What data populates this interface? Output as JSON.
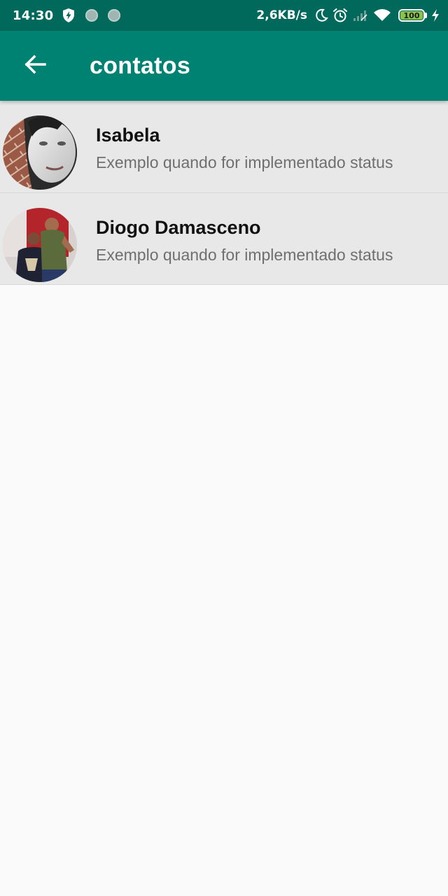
{
  "status_bar": {
    "time": "14:30",
    "net_speed": "2,6KB/s",
    "battery_level": "100",
    "icons": [
      "shield-bolt-icon",
      "notification-dot-icon",
      "notification-dot-icon",
      "moon-icon",
      "alarm-icon",
      "cellular-signal-icon",
      "wifi-icon",
      "battery-icon",
      "charging-bolt-icon"
    ]
  },
  "app_bar": {
    "title": "contatos",
    "back_icon": "arrow-left-icon",
    "background_color": "#008272"
  },
  "contacts": [
    {
      "name": "Isabela",
      "status": "Exemplo quando for implementado status",
      "avatar": "contact-photo"
    },
    {
      "name": "Diogo Damasceno",
      "status": "Exemplo quando for implementado status",
      "avatar": "contact-photo"
    }
  ],
  "colors": {
    "status_bar": "#00695c",
    "accent": "#008272",
    "list_item_bg": "#e8e8e8",
    "page_bg": "#fafafa"
  }
}
